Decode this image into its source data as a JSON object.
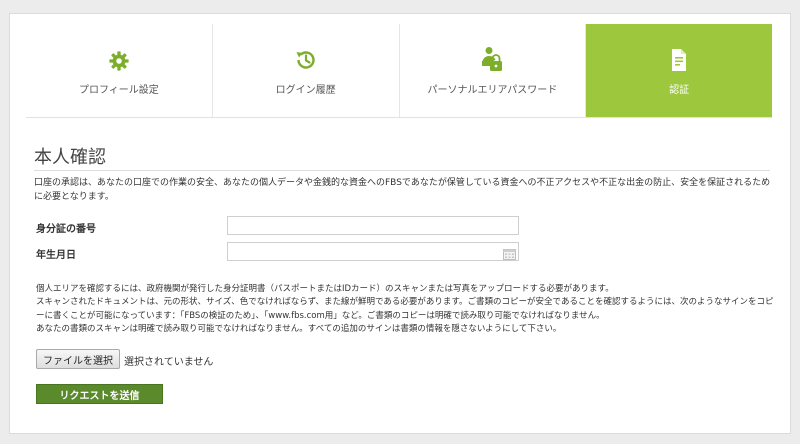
{
  "tabs": [
    {
      "label": "プロフィール設定",
      "icon": "gear-icon",
      "active": false
    },
    {
      "label": "ログイン履歴",
      "icon": "history-icon",
      "active": false
    },
    {
      "label": "パーソナルエリアパスワード",
      "icon": "user-lock-icon",
      "active": false
    },
    {
      "label": "認証",
      "icon": "document-icon",
      "active": true
    }
  ],
  "colors": {
    "accent": "#9dc73c",
    "button": "#5a8a2b",
    "icon_green": "#7cae2a"
  },
  "section": {
    "title": "本人確認",
    "description": "口座の承認は、あなたの口座での作業の安全、あなたの個人データや金銭的な資金へのFBSであなたが保管している資金への不正アクセスや不正な出金の防止、安全を保証されるために必要となります。"
  },
  "form": {
    "id_number_label": "身分証の番号",
    "id_number_value": "",
    "birthdate_label": "年生月日",
    "birthdate_value": ""
  },
  "notes": [
    "個人エリアを確認するには、政府機関が発行した身分証明書（パスポートまたはIDカード）のスキャンまたは写真をアップロードする必要があります。",
    "スキャンされたドキュメントは、元の形状、サイズ、色でなければならず、また線が鮮明である必要があります。ご書類のコピーが安全であることを確認するようには、次のようなサインをコピーに書くことが可能になっています：「FBSの検証のため」、「www.fbs.com用」など。ご書類のコピーは明確で読み取り可能でなければなりません。",
    "あなたの書類のスキャンは明確で読み取り可能でなければなりません。すべての追加のサインは書類の情報を隠さないようにして下さい。"
  ],
  "upload": {
    "button_label": "ファイルを選択",
    "status": "選択されていません"
  },
  "submit": {
    "label": "リクエストを送信"
  }
}
